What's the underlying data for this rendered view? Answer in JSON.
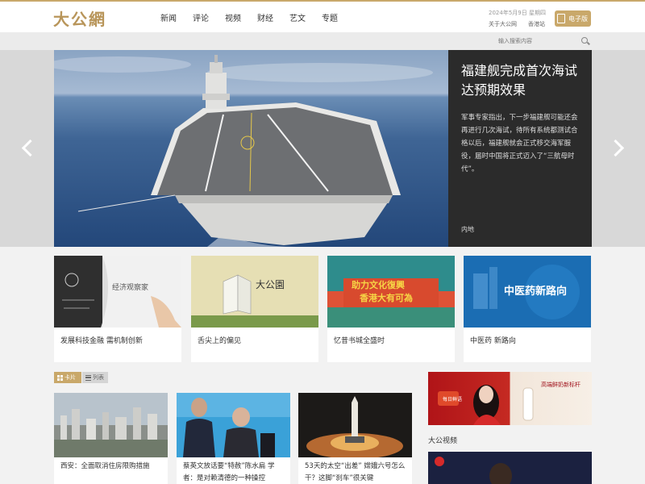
{
  "header": {
    "logo": "大公網",
    "nav": [
      "新闻",
      "评论",
      "视频",
      "财经",
      "艺文",
      "专题"
    ],
    "date": "2024年5月9日 星期四",
    "links": [
      "关于大公网",
      "香港站"
    ],
    "epaper_label": "电子版"
  },
  "search": {
    "placeholder": "输入搜索内容"
  },
  "hero": {
    "title": "福建舰完成首次海试 达预期效果",
    "summary": "军事专家指出，下一步福建舰可能还会再进行几次海试，待所有系统都测试合格以后，福建舰就会正式移交海军服役，届时中国将正式迈入了“三航母时代”。",
    "category": "内地"
  },
  "features": [
    {
      "title": "发展科技金融 需机制创新"
    },
    {
      "title": "舌尖上的偏见",
      "image_text": "大公園"
    },
    {
      "title": "忆昔书城全盛时",
      "image_text_1": "助力文化復興",
      "image_text_2": "香港大有可為"
    },
    {
      "title": "中医药 新路向",
      "image_text": "中医药新路向"
    }
  ],
  "tabs": {
    "card": "卡片",
    "list": "列表"
  },
  "news": [
    {
      "title": "西安：全面取消住房限购措施"
    },
    {
      "title": "蔡英文放话要“特赦”陈水扁 学者：是对赖清德的一种操控"
    },
    {
      "title": "53天的太空“出差” 嫦娥六号怎么干？这脚“刹车”很关键"
    }
  ],
  "sidebar": {
    "ad_text_1": "高端鲜奶新标杆",
    "ad_text_2": "每日鲜语",
    "video_label": "大公视频"
  },
  "colors": {
    "accent": "#c9a86a",
    "hero_panel": "#2b2b2b"
  }
}
